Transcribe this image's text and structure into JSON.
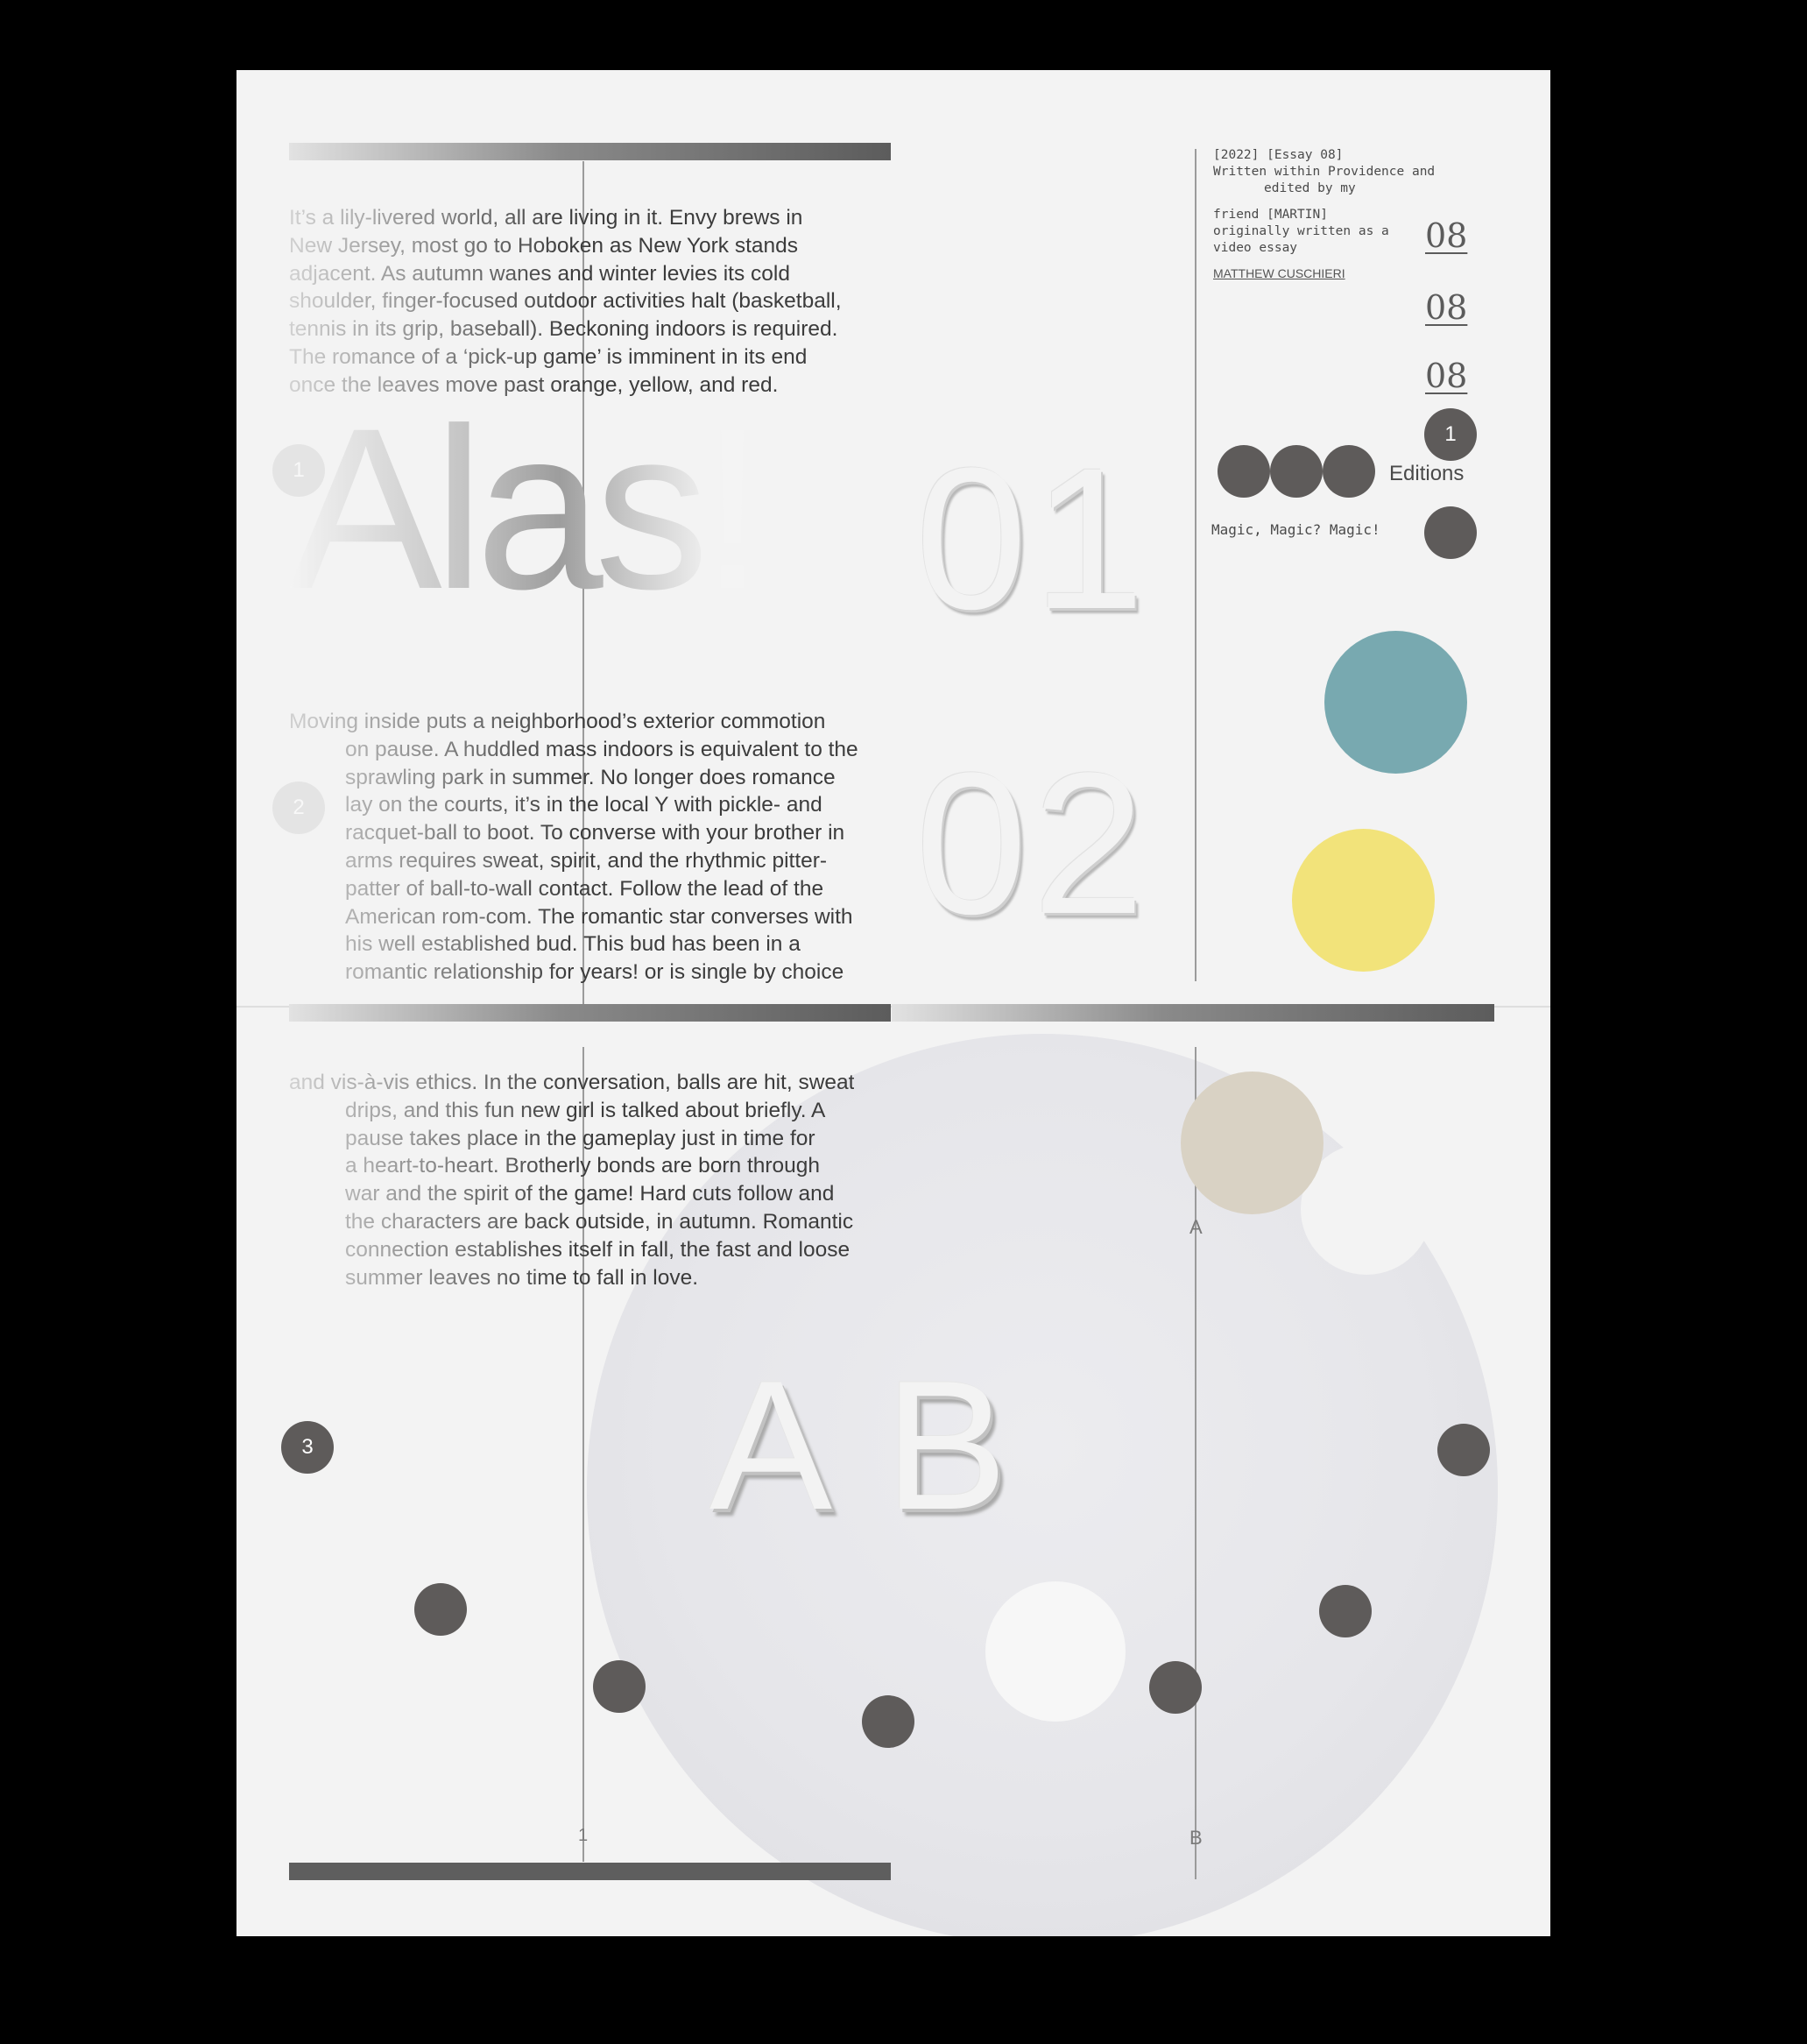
{
  "colophon": {
    "line1": "[2022] [Essay 08]",
    "line2": "Written within Providence and",
    "line3": "edited by my",
    "line4": "friend [MARTIN]",
    "line5": "originally written as a",
    "line6": "video essay",
    "author": "MATTHEW CUSCHIERI"
  },
  "edition_numbers": [
    "08",
    "08",
    "08"
  ],
  "editions_label": "Editions",
  "editions_badge": "1",
  "tagline": "Magic, Magic? Magic!",
  "headline": "Alas!",
  "section_numbers": [
    "01",
    "02"
  ],
  "section_markers": [
    "1",
    "2",
    "3"
  ],
  "letters": "AB",
  "axis_labels": {
    "a": "A",
    "b": "B",
    "one": "1"
  },
  "paragraphs": {
    "p1": [
      "It’s a lily-livered world, all are living in it. Envy brews in",
      "New Jersey, most go to Hoboken as New York stands",
      "adjacent. As autumn wanes and winter levies its cold",
      "shoulder, finger-focused outdoor activities halt (basketball,",
      "tennis in its grip, baseball). Beckoning indoors is required.",
      "The romance of a ‘pick-up game’ is imminent in its end",
      "once the leaves move past orange, yellow, and red."
    ],
    "p2": [
      "Moving inside puts a neighborhood’s exterior commotion",
      "on pause. A huddled mass indoors is equivalent to the",
      "sprawling park in summer. No longer does romance",
      "lay on the courts, it’s in the local Y with pickle- and",
      "racquet-ball to boot. To converse with your brother in",
      "arms requires sweat, spirit, and the rhythmic pitter-",
      "patter of ball-to-wall contact. Follow the lead of the",
      "American rom-com. The romantic star converses with",
      "his well established bud. This bud has been in a",
      "romantic relationship for years! or is single by choice"
    ],
    "p3": [
      "and vis-à-vis ethics. In the conversation, balls are hit, sweat",
      "drips, and this fun new girl is talked about briefly. A",
      "pause takes place in the gameplay just in time for",
      "a heart-to-heart. Brotherly bonds are born  through",
      "war and the spirit of the game! Hard cuts follow and",
      "the characters are back outside, in autumn. Romantic",
      "connection establishes itself in fall, the fast and loose",
      "summer leaves no time to fall in love."
    ]
  },
  "colors": {
    "teal": "#78a9b0",
    "yellow": "#f2e37a",
    "beige": "#d9d2c4",
    "dot": "#5e5b5a"
  }
}
